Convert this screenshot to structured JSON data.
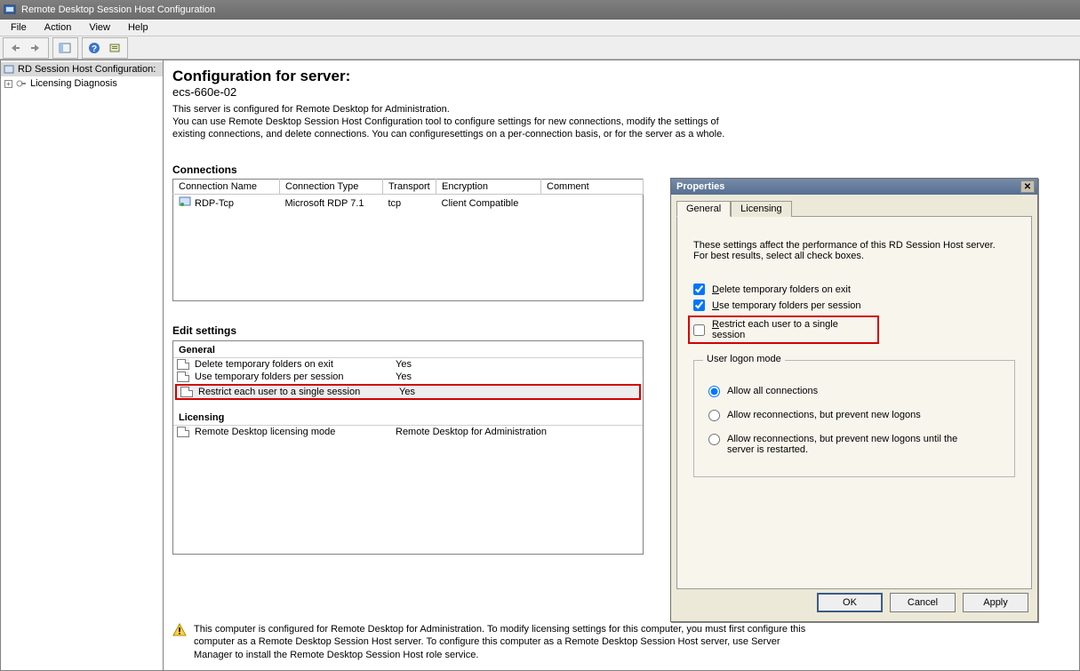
{
  "title": "Remote Desktop Session Host Configuration",
  "menu": {
    "file": "File",
    "action": "Action",
    "view": "View",
    "help": "Help"
  },
  "tree": {
    "root": "RD Session Host Configuration:",
    "child1": "Licensing Diagnosis"
  },
  "page": {
    "heading": "Configuration for server:",
    "server": "ecs-660e-02",
    "intro1": "This server is configured for Remote Desktop for Administration.",
    "intro2": "You can use Remote Desktop Session Host Configuration tool to configure settings for new connections, modify the settings of",
    "intro3": "existing connections, and delete connections. You can configuresettings on a per-connection basis, or for the server as a whole."
  },
  "connections": {
    "title": "Connections",
    "headers": {
      "name": "Connection Name",
      "type": "Connection Type",
      "transport": "Transport",
      "encryption": "Encryption",
      "comment": "Comment"
    },
    "rows": [
      {
        "name": "RDP-Tcp",
        "type": "Microsoft RDP 7.1",
        "transport": "tcp",
        "encryption": "Client Compatible",
        "comment": ""
      }
    ]
  },
  "edit": {
    "title": "Edit settings",
    "general": "General",
    "r1": {
      "label": "Delete temporary folders on exit",
      "value": "Yes"
    },
    "r2": {
      "label": "Use temporary folders per session",
      "value": "Yes"
    },
    "r3": {
      "label": "Restrict each user to a single session",
      "value": "Yes"
    },
    "licensing": "Licensing",
    "r4": {
      "label": "Remote Desktop licensing mode",
      "value": "Remote Desktop for Administration"
    }
  },
  "footer": "This computer is configured for Remote Desktop for Administration. To modify licensing settings for this computer, you must first configure this computer as a Remote Desktop Session Host server. To configure this computer as a Remote Desktop Session Host server, use Server Manager to install the Remote Desktop Session Host role service.",
  "dialog": {
    "title": "Properties",
    "tab_general": "General",
    "tab_licensing": "Licensing",
    "instructions1": "These settings affect the performance of this RD Session Host server.",
    "instructions2": "For best results, select all check boxes.",
    "chk1_pre": "D",
    "chk1_rest": "elete temporary folders on exit",
    "chk2_pre": "U",
    "chk2_rest": "se temporary folders per session",
    "chk3_pre": "R",
    "chk3_rest": "estrict each user to a single session",
    "group": "User logon mode",
    "radio1_pre": "A",
    "radio1_rest": "llow all connections",
    "radio2_rest": "Allow ",
    "radio2_under": "r",
    "radio2_after": "econnections, but prevent new logons",
    "radio3": "Allow reconnections, but prevent new logons until the server is restarted.",
    "ok": "OK",
    "cancel": "Cancel",
    "apply": "Apply"
  }
}
